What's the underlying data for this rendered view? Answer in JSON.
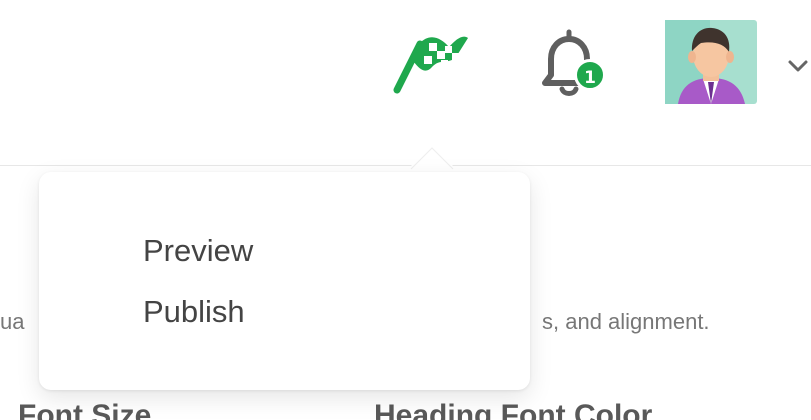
{
  "header": {
    "notification_count": "1",
    "icons": {
      "publish_flag": "checkered-flag-icon",
      "notifications": "bell-icon",
      "profile": "user-avatar",
      "profile_menu": "chevron-down-icon"
    },
    "colors": {
      "accent": "#1fa84d",
      "text": "#444444",
      "muted": "#777777"
    }
  },
  "dropdown": {
    "items": [
      {
        "label": "Preview"
      },
      {
        "label": "Publish"
      }
    ]
  },
  "background": {
    "description_left_partial": "ua",
    "description_right_partial": "s, and alignment.",
    "heading_left_partial": "Font Size",
    "heading_right_partial": "Heading Font Color"
  }
}
